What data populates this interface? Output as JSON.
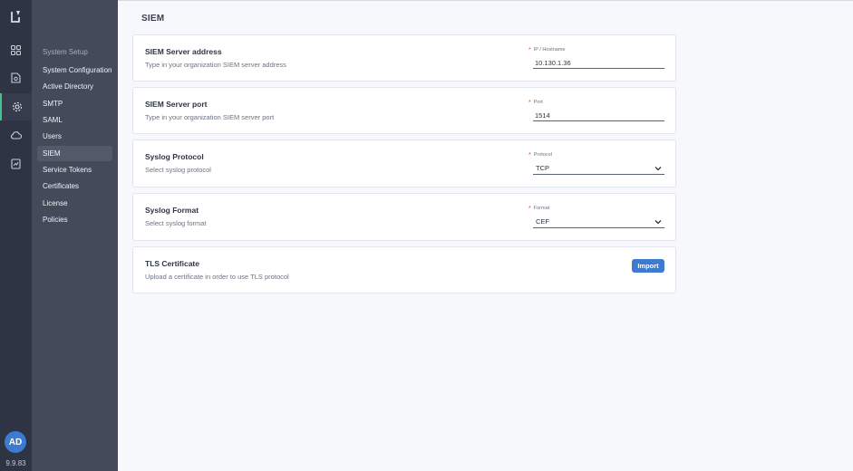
{
  "app": {
    "logo_icon": "brand-logo-icon",
    "version": "9.9.83",
    "avatar_initials": "AD"
  },
  "rail": {
    "items": [
      {
        "icon": "dashboard-grid-icon",
        "active": false
      },
      {
        "icon": "document-shield-icon",
        "active": false
      },
      {
        "icon": "gear-icon",
        "active": true
      },
      {
        "icon": "cloud-icon",
        "active": false
      },
      {
        "icon": "report-icon",
        "active": false
      }
    ]
  },
  "sidebar": {
    "section_title": "System Setup",
    "items": [
      {
        "label": "System Configuration",
        "active": false
      },
      {
        "label": "Active Directory",
        "active": false
      },
      {
        "label": "SMTP",
        "active": false
      },
      {
        "label": "SAML",
        "active": false
      },
      {
        "label": "Users",
        "active": false
      },
      {
        "label": "SIEM",
        "active": true
      },
      {
        "label": "Service Tokens",
        "active": false
      },
      {
        "label": "Certificates",
        "active": false
      },
      {
        "label": "License",
        "active": false
      },
      {
        "label": "Policies",
        "active": false
      }
    ]
  },
  "page": {
    "title": "SIEM"
  },
  "cards": {
    "server_address": {
      "title": "SIEM Server address",
      "description": "Type in your organization SIEM server address",
      "field_label": "IP / Hostname",
      "value": "10.130.1.36"
    },
    "server_port": {
      "title": "SIEM Server port",
      "description": "Type in your organization SIEM server port",
      "field_label": "Port",
      "value": "1514"
    },
    "protocol": {
      "title": "Syslog Protocol",
      "description": "Select syslog protocol",
      "field_label": "Protocol",
      "value": "TCP"
    },
    "format": {
      "title": "Syslog Format",
      "description": "Select syslog format",
      "field_label": "Format",
      "value": "CEF"
    },
    "tls": {
      "title": "TLS Certificate",
      "description": "Upload a certificate in order to use TLS protocol",
      "button_label": "Import"
    }
  },
  "colors": {
    "rail_bg": "#2e3443",
    "sidebar_bg": "#434a5a",
    "accent": "#3fc38d",
    "primary_button": "#3d7bd1",
    "required_marker": "#e0464a"
  },
  "required_marker": "*"
}
